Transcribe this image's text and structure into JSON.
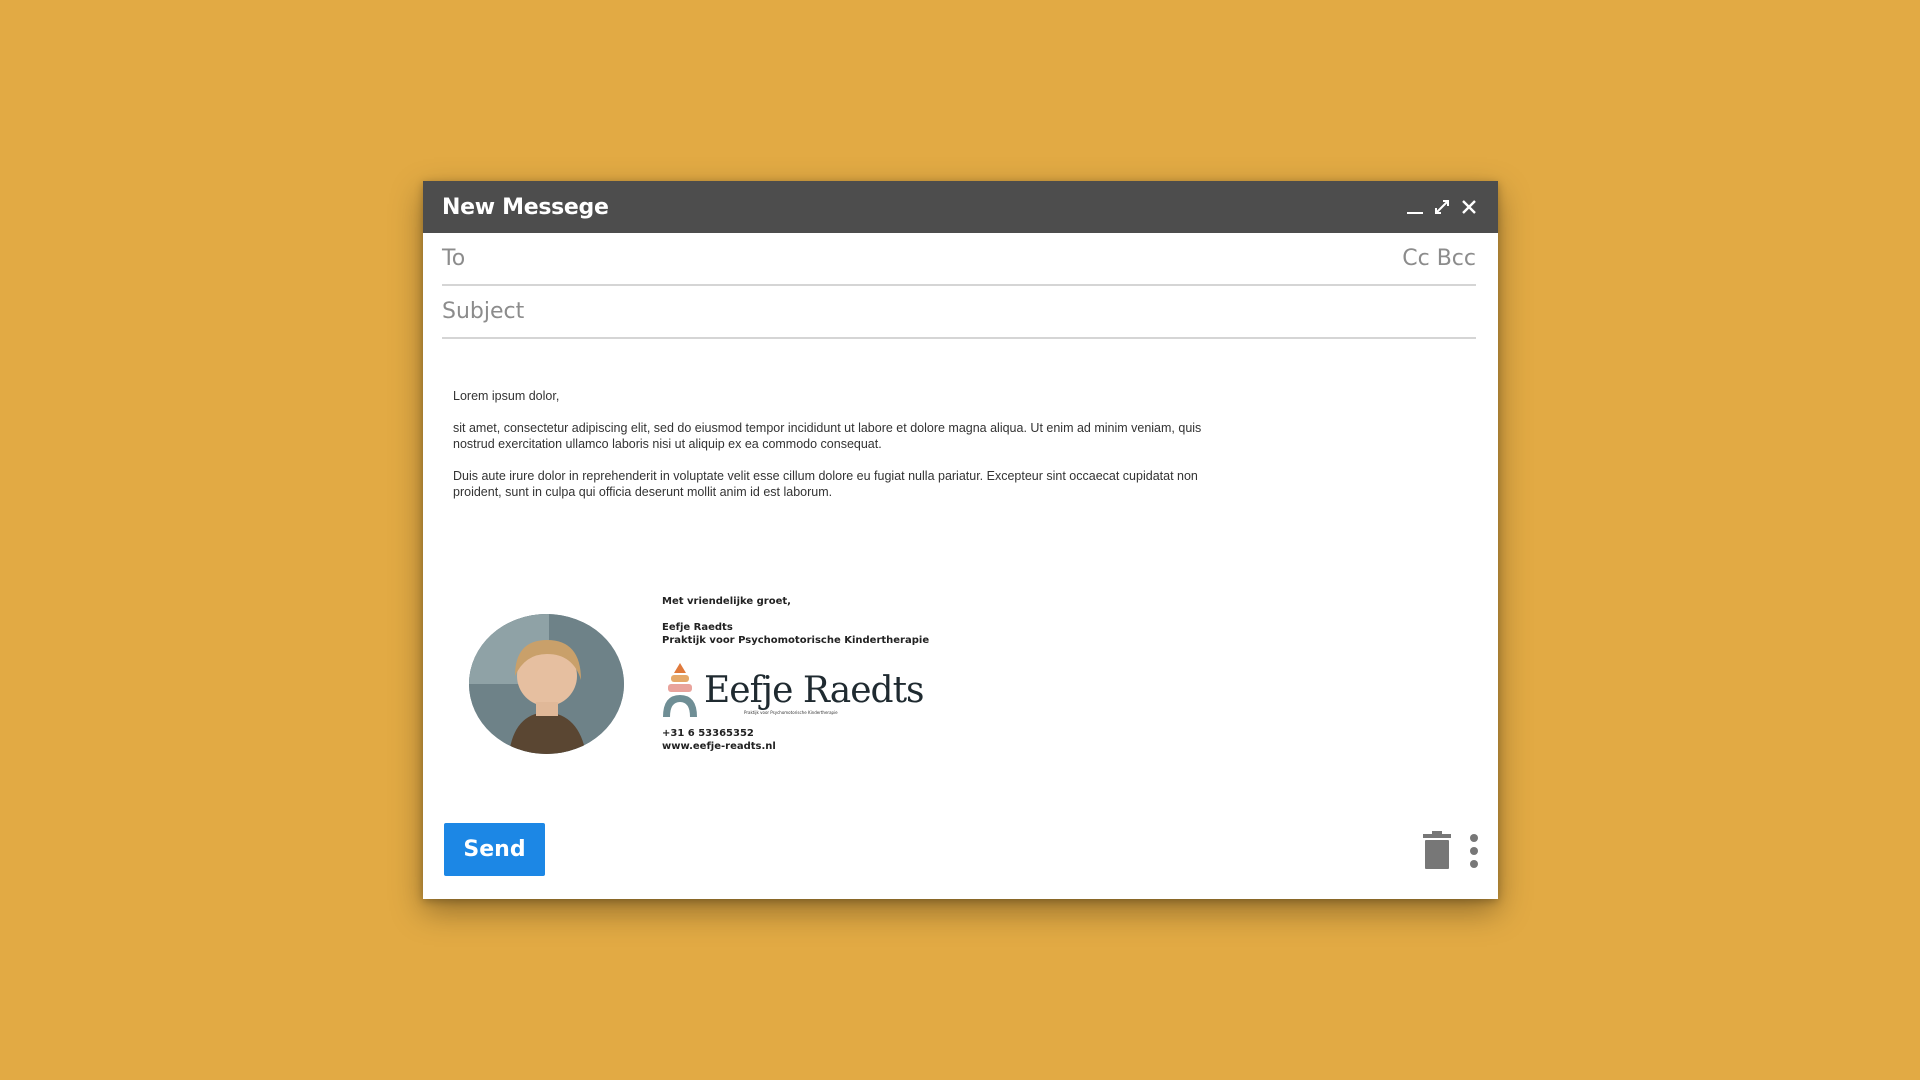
{
  "window": {
    "title": "New Messege"
  },
  "compose": {
    "to_label": "To",
    "cc_bcc_label": "Cc Bcc",
    "subject_label": "Subject"
  },
  "body": {
    "greeting": "Lorem ipsum dolor,",
    "paragraph_1": "sit amet, consectetur adipiscing elit, sed do eiusmod tempor incididunt ut labore et dolore magna aliqua. Ut enim ad minim veniam, quis nostrud exercitation ullamco laboris nisi ut aliquip ex ea commodo consequat.",
    "paragraph_2": "Duis aute irure dolor in reprehenderit in voluptate velit esse cillum dolore eu fugiat nulla pariatur. Excepteur sint occaecat cupidatat non proident, sunt in culpa qui officia deserunt mollit anim id est laborum."
  },
  "signature": {
    "closing": "Met vriendelijke groet,",
    "name": "Eefje Raedts",
    "practice": "Praktijk voor Psychomotorische Kindertherapie",
    "logo_name": "Eefje Raedts",
    "logo_tagline": "Praktijk voor Psychomotorische Kindertherapie",
    "phone": "+31 6 53365352",
    "website": "www.eefje-readts.nl"
  },
  "actions": {
    "send_label": "Send"
  },
  "colors": {
    "background": "#E2AA44",
    "titlebar": "#4D4D4D",
    "send_button": "#1C87E5"
  }
}
